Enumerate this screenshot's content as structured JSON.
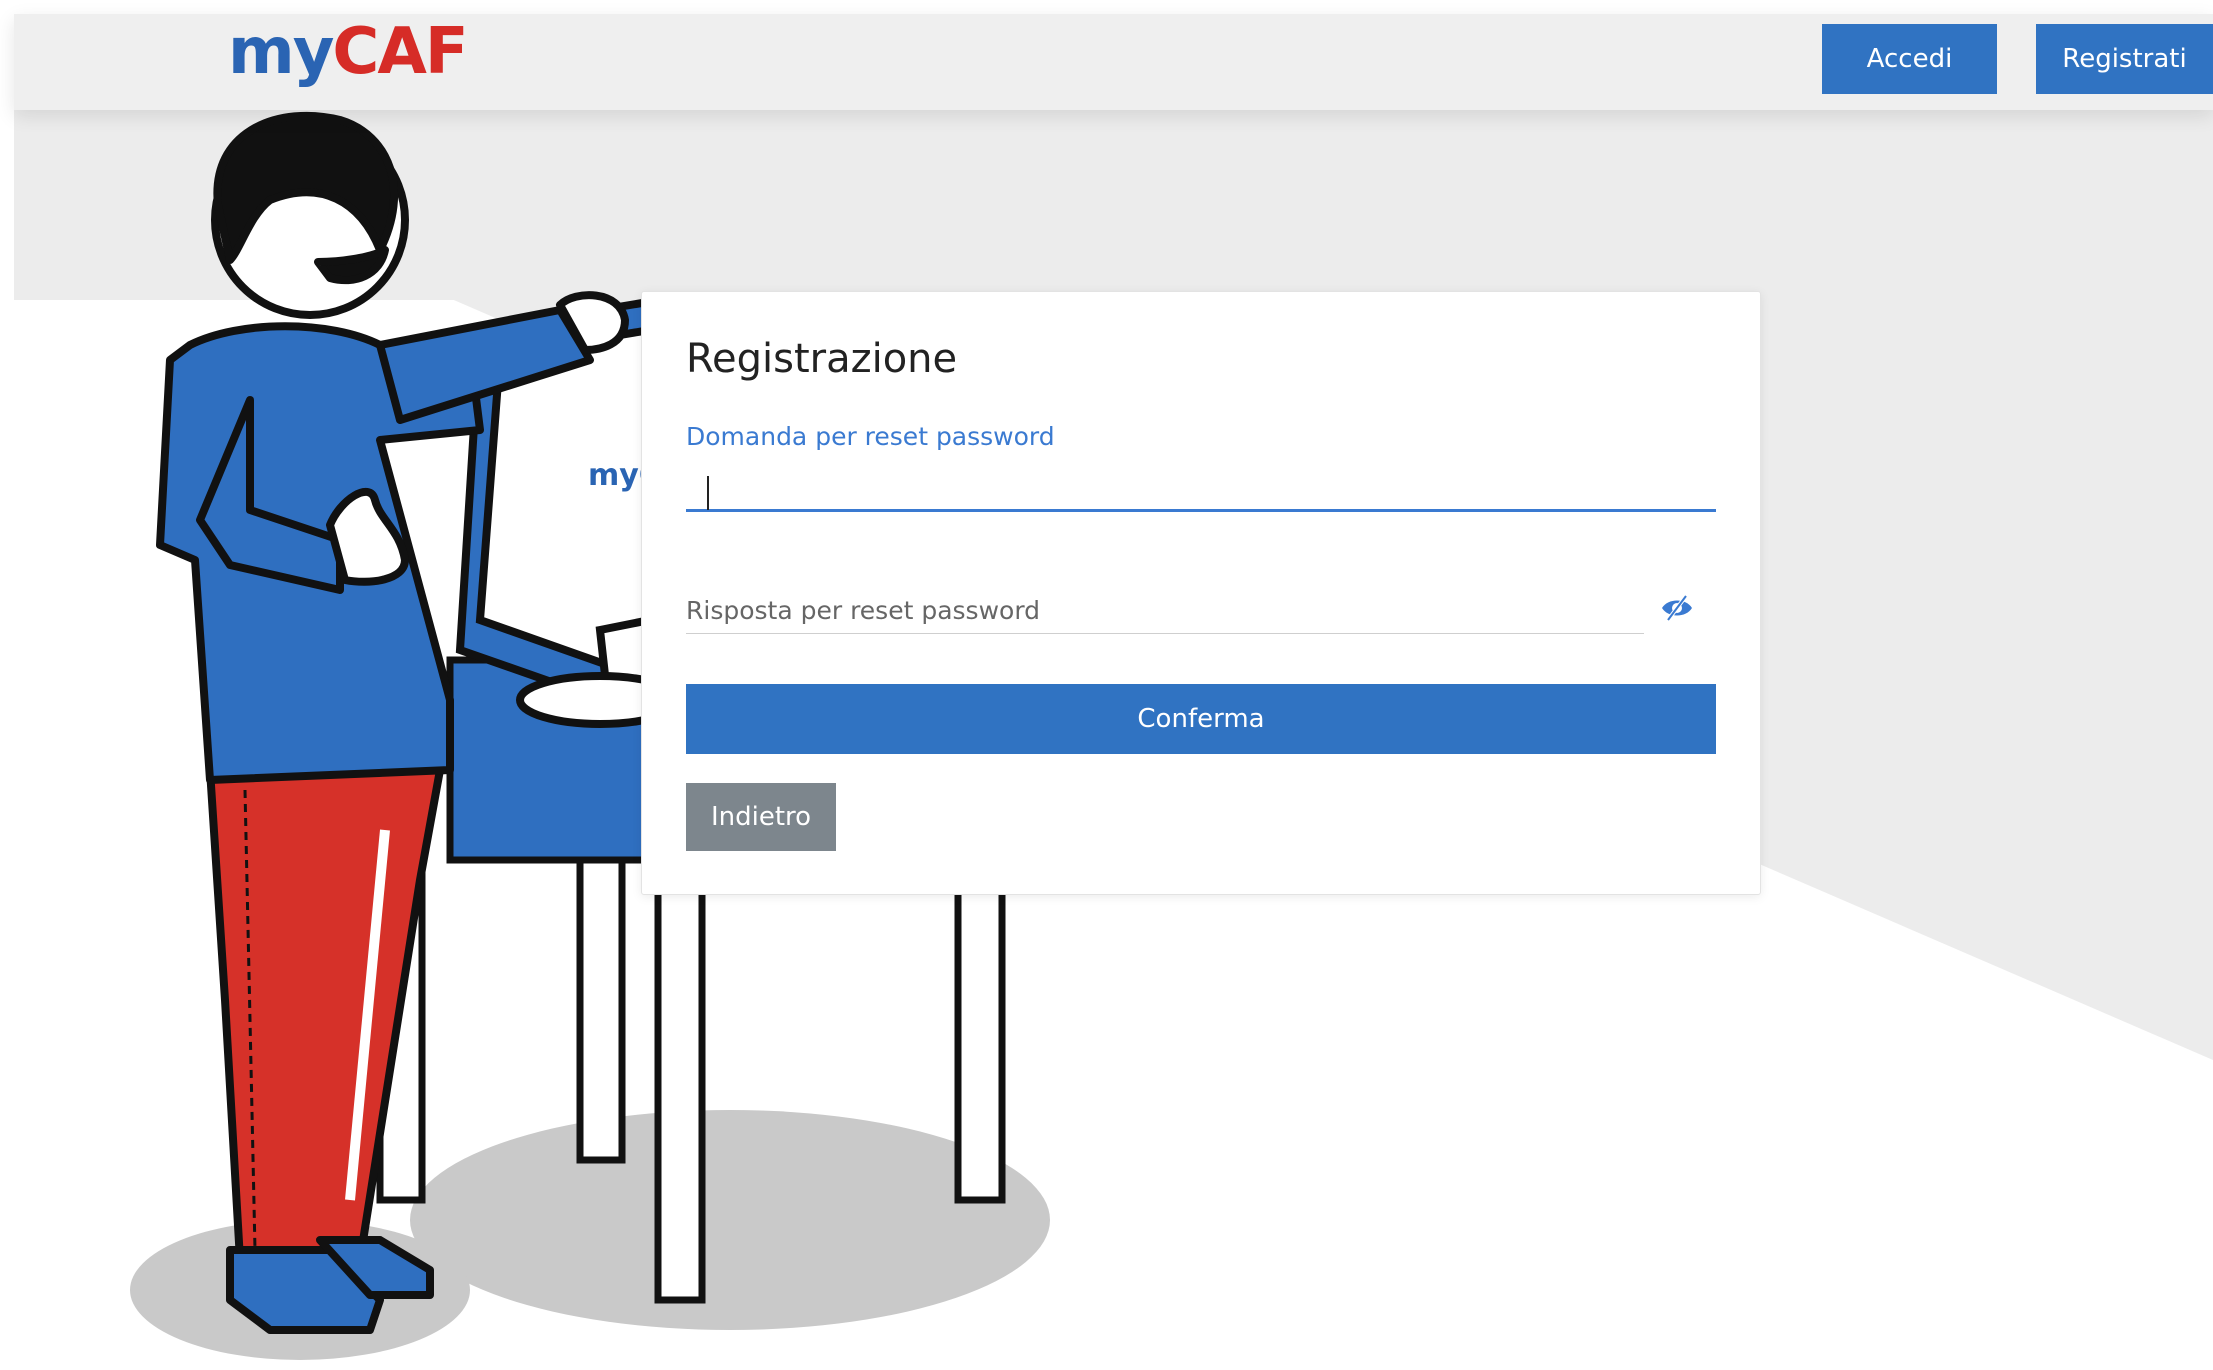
{
  "header": {
    "logo_my": "my",
    "logo_caf": "CAF",
    "login_label": "Accedi",
    "register_label": "Registrati"
  },
  "illustration": {
    "monitor_logo_text": "myC"
  },
  "form": {
    "title": "Registrazione",
    "question_label": "Domanda per reset password",
    "question_value": "",
    "answer_placeholder": "Risposta per reset password",
    "answer_toggle_icon": "eye-slash-icon",
    "confirm_label": "Conferma",
    "back_label": "Indietro"
  },
  "colors": {
    "primary": "#3073c2",
    "focus": "#3a7ad1",
    "secondary_button": "#7d868d",
    "logo_blue": "#2a64b3",
    "logo_red": "#d62c27"
  }
}
